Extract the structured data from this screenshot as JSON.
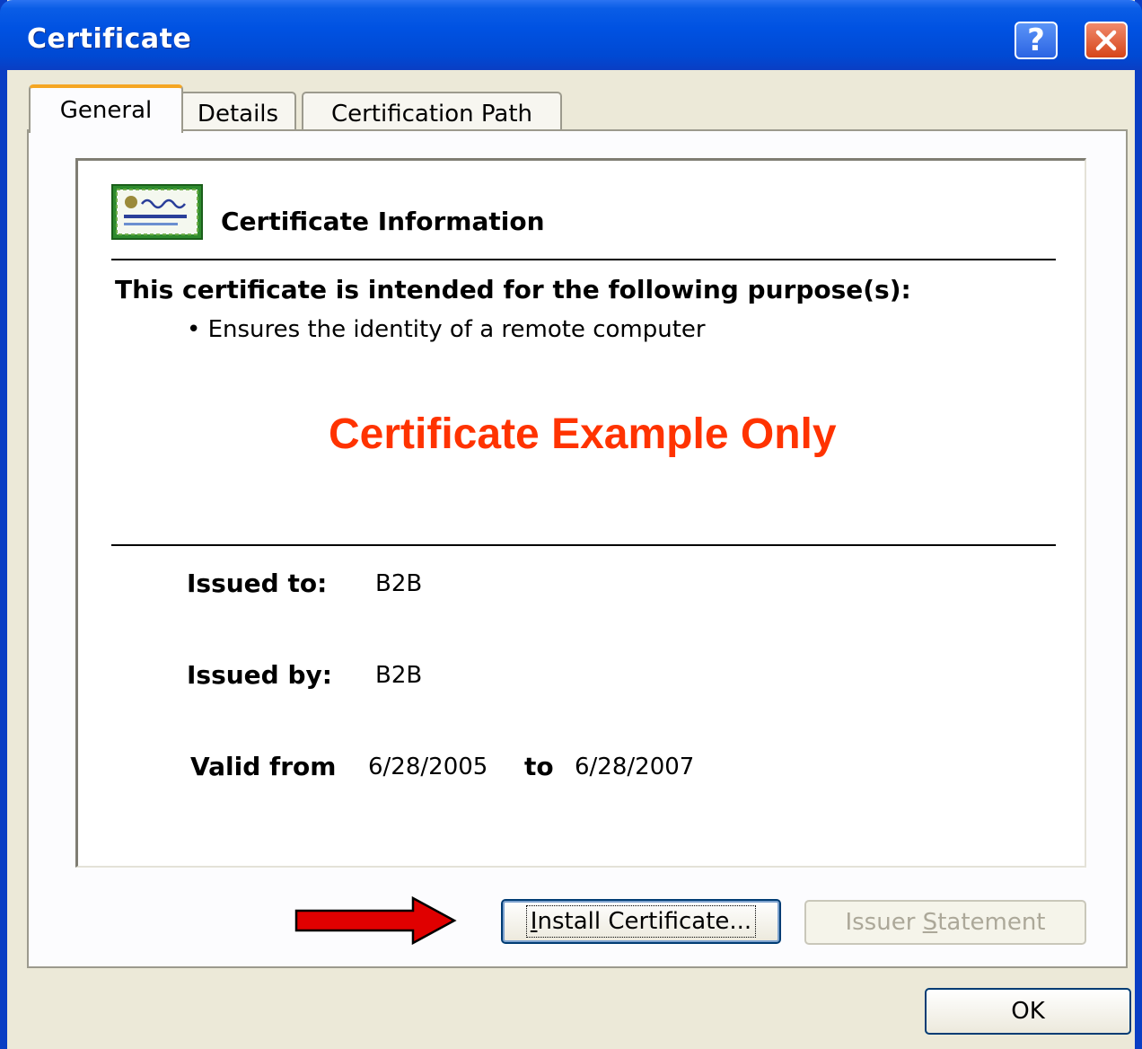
{
  "window": {
    "title": "Certificate",
    "help_label": "?",
    "colors": {
      "titlebar": "#0052e2",
      "close": "#d64519",
      "watermark": "#ff3300",
      "arrow": "#e00000"
    }
  },
  "tabs": [
    {
      "label": "General",
      "selected": true
    },
    {
      "label": "Details",
      "selected": false
    },
    {
      "label": "Certification Path",
      "selected": false
    }
  ],
  "info": {
    "icon": "certificate-icon",
    "title": "Certificate Information",
    "purpose_heading": "This certificate is intended for the following purpose(s):",
    "purposes": [
      "Ensures the identity of a remote computer"
    ],
    "watermark": "Certificate Example Only",
    "issued_to_label": "Issued to:",
    "issued_to": "B2B",
    "issued_by_label": "Issued by:",
    "issued_by": "B2B",
    "valid_from_label": "Valid from",
    "valid_from": "6/28/2005",
    "valid_to_label": "to",
    "valid_to": "6/28/2007"
  },
  "buttons": {
    "install_mnemonic": "I",
    "install_rest": "nstall Certificate...",
    "issuer_pre": "Issuer ",
    "issuer_mnemonic": "S",
    "issuer_rest": "tatement",
    "ok": "OK"
  },
  "annotation": {
    "icon": "arrow-right-icon"
  }
}
